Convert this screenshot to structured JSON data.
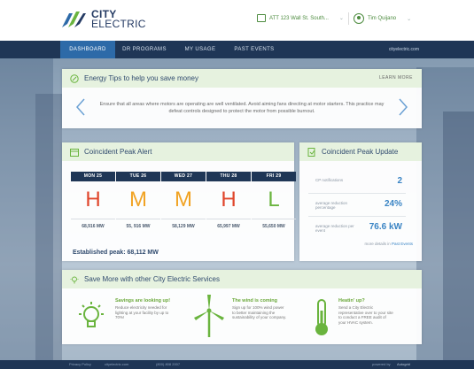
{
  "brand": {
    "line1": "CITY",
    "line2": "ELECTRIC"
  },
  "account": {
    "address": "ATT 123 Wall St. South...",
    "icon": "building-icon"
  },
  "user": {
    "name": "Tim Quijano",
    "icon": "avatar-icon"
  },
  "nav": {
    "tabs": [
      "DASHBOARD",
      "DR PROGRAMS",
      "MY USAGE",
      "PAST EVENTS"
    ],
    "active": "DASHBOARD",
    "site": "cityelectric.com"
  },
  "tips": {
    "title": "Energy Tips to help you save money",
    "learn_more": "LEARN MORE",
    "text": "Ensure that all areas where motors are operating are well ventilated. Avoid aiming fans directing at motor starters. This practice may defeat controls designed to protect the motor from possible burnout."
  },
  "peak_alert": {
    "title": "Coincident Peak Alert",
    "days": [
      {
        "day": "MON 25",
        "level": "H",
        "mw": "68,916 MW"
      },
      {
        "day": "TUE 26",
        "level": "M",
        "mw": "55, 916 MW"
      },
      {
        "day": "WED 27",
        "level": "M",
        "mw": "58,129 MW"
      },
      {
        "day": "THU 28",
        "level": "H",
        "mw": "65,997 MW"
      },
      {
        "day": "FRI 29",
        "level": "L",
        "mw": "55,650 MW"
      }
    ],
    "established": "Established peak: 68,112 MW",
    "colors": {
      "H": "#e0462c",
      "M": "#f1a324",
      "L": "#6ab43e"
    }
  },
  "peak_update": {
    "title": "Coincident Peak Update",
    "rows": [
      {
        "label": "CP notifications",
        "value": "2"
      },
      {
        "label": "average reduction percentage",
        "value": "24%"
      },
      {
        "label": "average reduction per event",
        "value": "76.6 kW"
      }
    ],
    "more_prefix": "more details in",
    "more_link": "Past Events"
  },
  "services": {
    "title": "Save More with other City Electric Services",
    "items": [
      {
        "title": "Savings are looking up!",
        "desc": "Reduce electricity needed for lighting at your facility by up to 70%!",
        "icon": "lightbulb-icon"
      },
      {
        "title": "The wind is coming",
        "desc": "Sign up for 100% wind power to better maintaining the sustainability of your company.",
        "icon": "wind-turbine-icon"
      },
      {
        "title": "Heatin' up?",
        "desc": "Send a City Electric representative over to your site to conduct a FREE audit of your HVAC system.",
        "icon": "thermometer-icon"
      }
    ]
  },
  "footer": {
    "privacy": "Privacy Policy",
    "site": "cityelectric.com",
    "phone": "(800) 808 2007",
    "powered": "powered by",
    "powered_brand": "Autogrid"
  }
}
